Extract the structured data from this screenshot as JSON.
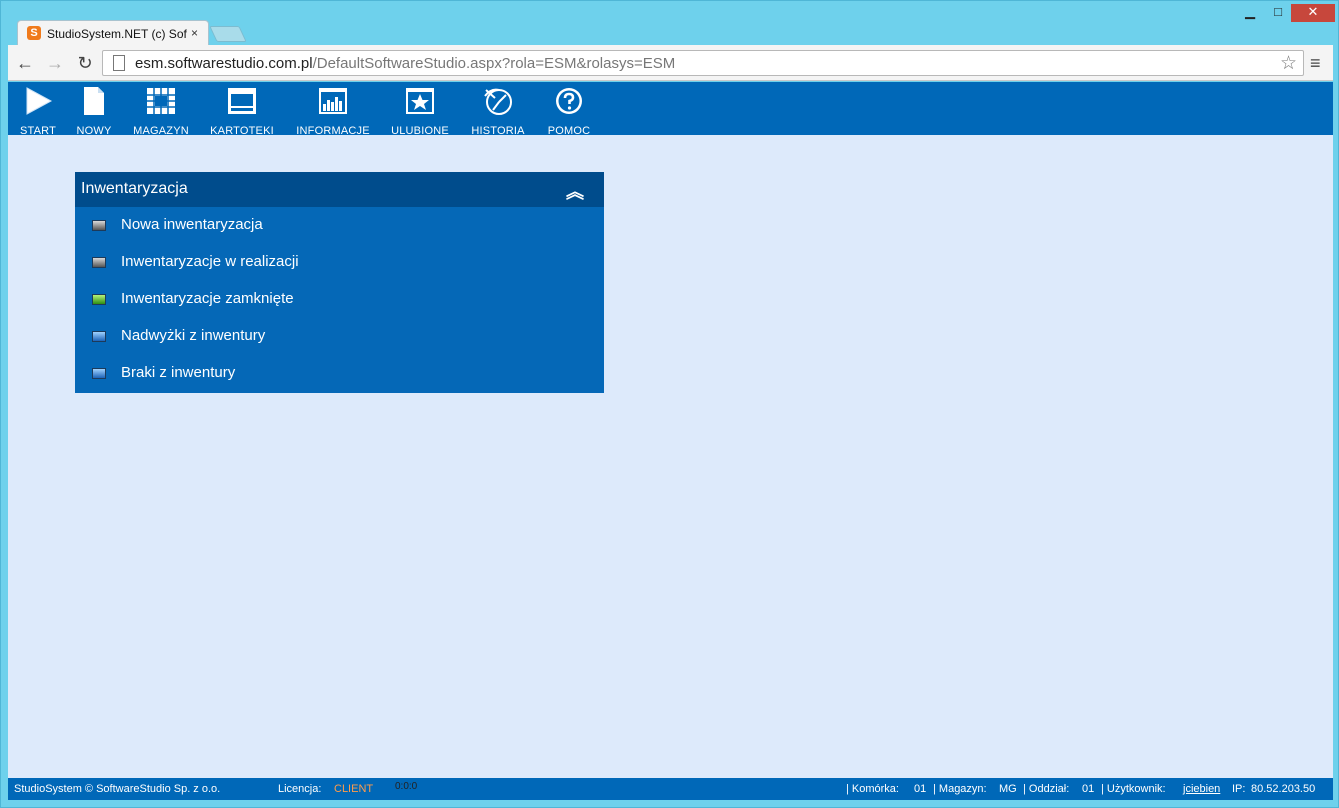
{
  "browser": {
    "tab_title": "StudioSystem.NET (c) Soft",
    "tab_close": "×",
    "url_host": "esm.softwarestudio.com.pl",
    "url_path": "/DefaultSoftwareStudio.aspx?rola=ESM&rolasys=ESM",
    "win_min": "▁",
    "win_max": "□",
    "win_close": "✕",
    "back": "←",
    "forward": "→",
    "reload": "↻",
    "star": "☆",
    "menu": "≡"
  },
  "appbar": {
    "buttons": [
      {
        "label": "START",
        "icon": "play-icon"
      },
      {
        "label": "NOWY",
        "icon": "new-document-icon"
      },
      {
        "label": "MAGAZYN",
        "icon": "warehouse-grid-icon"
      },
      {
        "label": "KARTOTEKI",
        "icon": "card-file-icon"
      },
      {
        "label": "INFORMACJE",
        "icon": "bar-chart-icon"
      },
      {
        "label": "ULUBIONE",
        "icon": "star-icon"
      },
      {
        "label": "HISTORIA",
        "icon": "history-icon"
      },
      {
        "label": "POMOC",
        "icon": "help-icon"
      }
    ]
  },
  "panel": {
    "title": "Inwentaryzacja",
    "collapse": "︽",
    "items": [
      {
        "label": "Nowa inwentaryzacja",
        "bullet": "gray"
      },
      {
        "label": "Inwentaryzacje w realizacji",
        "bullet": "gray"
      },
      {
        "label": "Inwentaryzacje zamknięte",
        "bullet": "green"
      },
      {
        "label": "Nadwyżki z inwentury",
        "bullet": "blue"
      },
      {
        "label": "Braki z inwentury",
        "bullet": "blue"
      }
    ]
  },
  "status": {
    "copyright": "StudioSystem © SoftwareStudio Sp. z o.o.",
    "license_label": "Licencja:",
    "license_value": "CLIENT",
    "timer": "0:0:0",
    "cell_label": "| Komórka:",
    "cell_value": "01",
    "warehouse_label": "| Magazyn:",
    "warehouse_value": "MG",
    "branch_label": "| Oddział:",
    "branch_value": "01",
    "user_label": "| Użytkownik:",
    "user_value": "jciebien",
    "ip_label": "IP:",
    "ip_value": "80.52.203.50"
  },
  "colors": {
    "appbar": "#0068b8",
    "panel_header": "#004c8c",
    "panel_body": "#0568b7",
    "background": "#ddeafb",
    "license_accent": "#ff9b4a"
  }
}
